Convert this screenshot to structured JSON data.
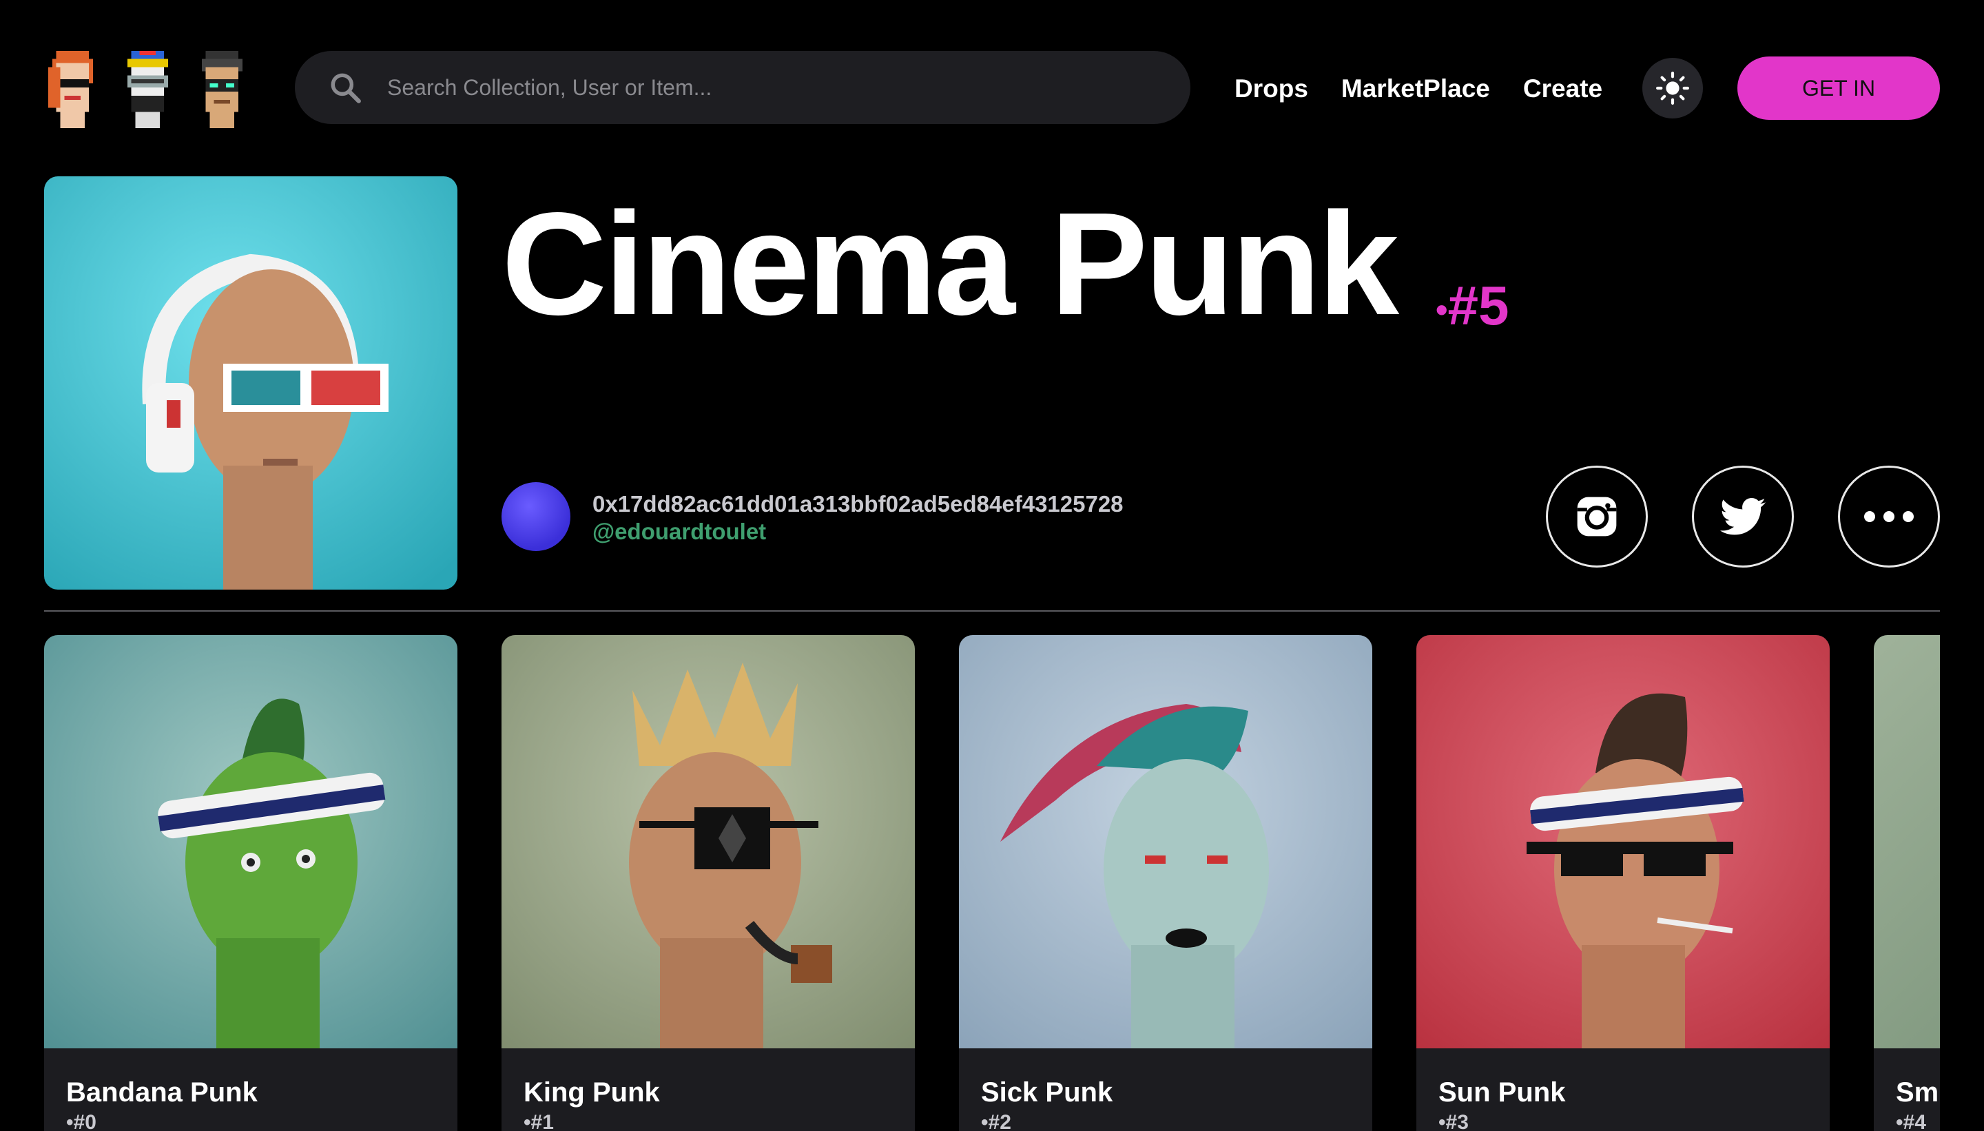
{
  "header": {
    "logo_icons": [
      "punk-redhead-icon",
      "punk-visor-icon",
      "punk-glasses-icon"
    ],
    "search": {
      "placeholder": "Search Collection, User or Item...",
      "icon": "search-icon"
    },
    "nav": [
      "Drops",
      "MarketPlace",
      "Create"
    ],
    "theme_toggle_icon": "sun-icon",
    "cta_label": "GET IN"
  },
  "hero": {
    "title": "Cinema Punk",
    "number": "#5",
    "owner": {
      "address": "0x17dd82ac61dd01a313bbf02ad5ed84ef43125728",
      "handle": "@edouardtoulet"
    },
    "social_icons": [
      "instagram-icon",
      "twitter-icon",
      "more-icon"
    ]
  },
  "cards": [
    {
      "name": "Bandana Punk",
      "number": "#0"
    },
    {
      "name": "King Punk",
      "number": "#1"
    },
    {
      "name": "Sick Punk",
      "number": "#2"
    },
    {
      "name": "Sun Punk",
      "number": "#3"
    },
    {
      "name": "Sm",
      "number": "#4"
    }
  ],
  "colors": {
    "accent": "#e236c9",
    "background": "#000000",
    "handle": "#3f9f6f",
    "search_bg": "#1e1e22"
  }
}
